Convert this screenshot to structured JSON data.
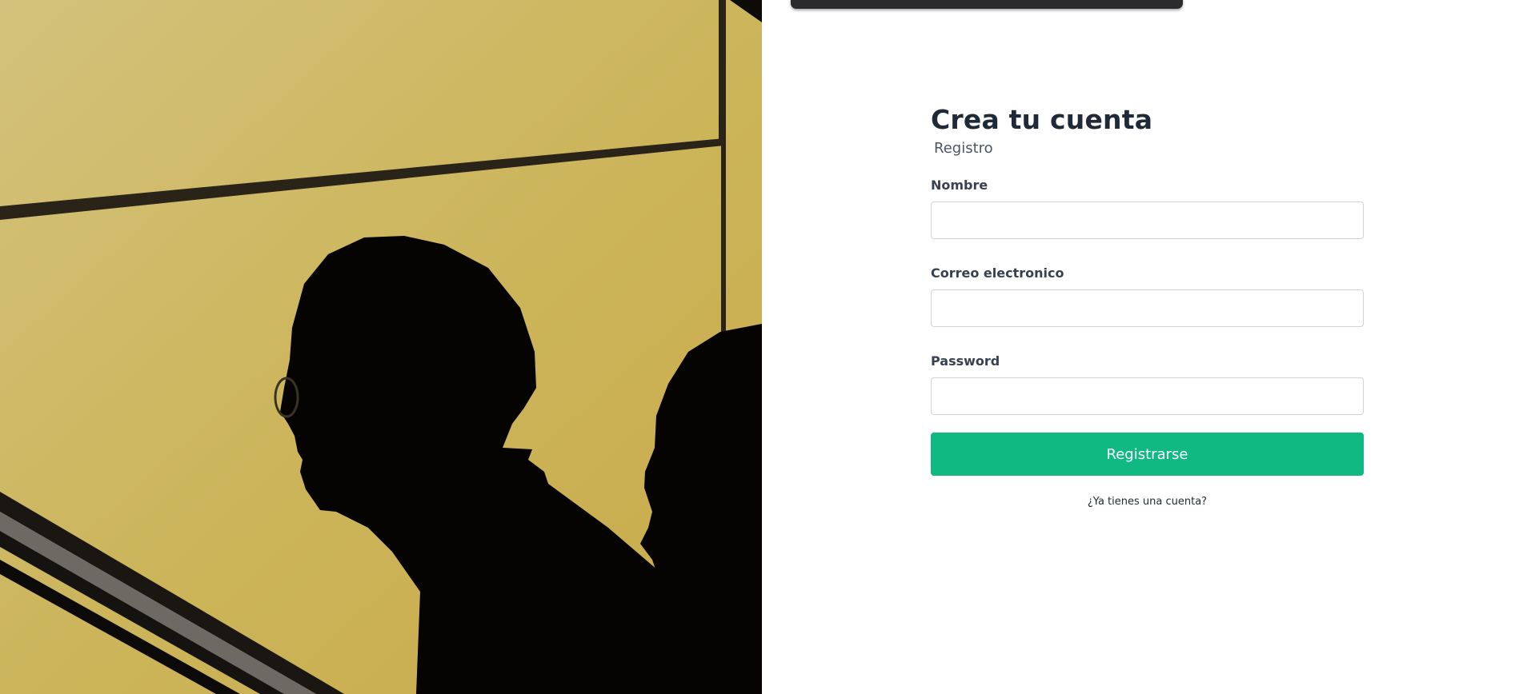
{
  "form": {
    "title": "Crea tu cuenta",
    "subtitle": "Registro",
    "fields": [
      {
        "label": "Nombre",
        "value": "",
        "placeholder": ""
      },
      {
        "label": "Correo electronico",
        "value": "",
        "placeholder": ""
      },
      {
        "label": "Password",
        "value": "",
        "placeholder": ""
      }
    ],
    "submit_label": "Registrarse",
    "login_link": "¿Ya tienes una cuenta?"
  },
  "colors": {
    "accent": "#10b981",
    "title": "#1f2937",
    "photo_background": "#cdb45a",
    "top_bar": "#2b2b2d"
  }
}
